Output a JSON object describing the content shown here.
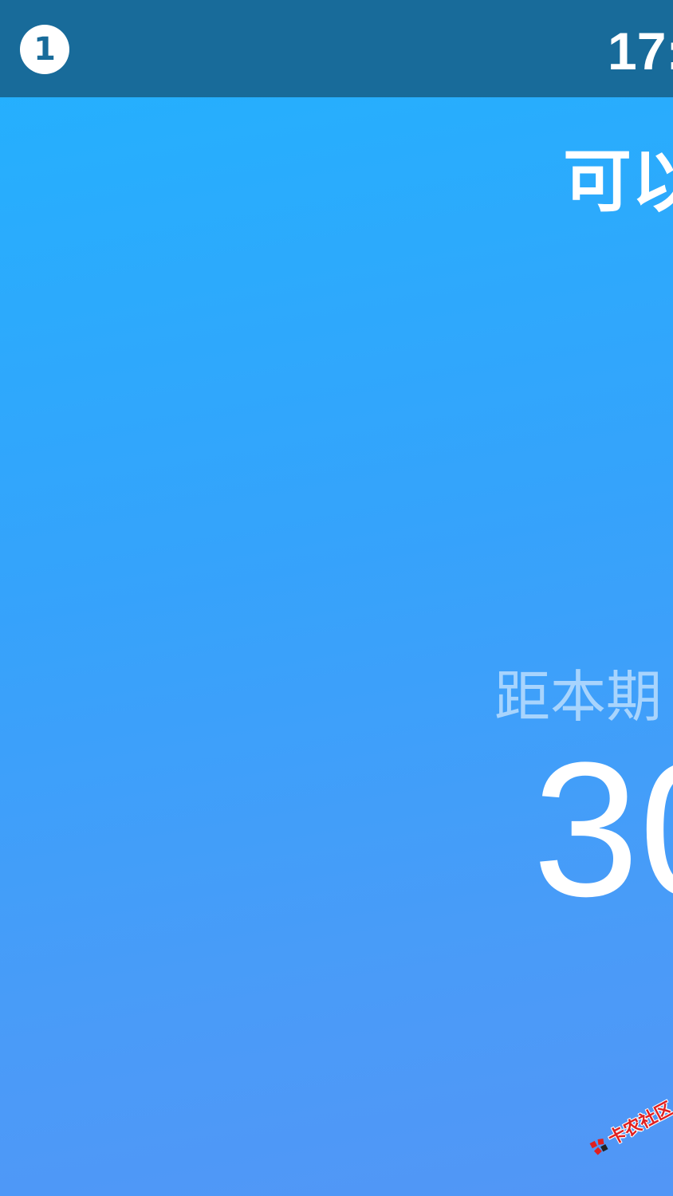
{
  "status_bar": {
    "notification_count": "1",
    "time": "17:"
  },
  "main": {
    "headline": "可以",
    "countdown_label": "距本期",
    "countdown_value": "30"
  },
  "watermark": {
    "text": "卡农社区",
    "logo_icon": "kanong-logo-icon"
  },
  "colors": {
    "status_bar_bg": "#186b9a",
    "gradient_top": "#22b2fe",
    "gradient_bottom": "#5296f6",
    "watermark_red": "#e02020"
  }
}
